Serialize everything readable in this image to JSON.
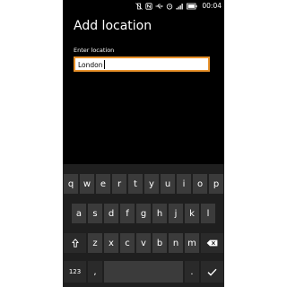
{
  "status": {
    "time": "00:04",
    "icons": [
      "vibrate-off-icon",
      "nfc-icon",
      "usb-icon",
      "alarm-icon",
      "signal-icon",
      "battery-icon"
    ]
  },
  "page": {
    "title": "Add location"
  },
  "location_field": {
    "label": "Enter location",
    "value": "London"
  },
  "keyboard": {
    "row1": [
      "q",
      "w",
      "e",
      "r",
      "t",
      "y",
      "u",
      "i",
      "o",
      "p"
    ],
    "row2": [
      "a",
      "s",
      "d",
      "f",
      "g",
      "h",
      "j",
      "k",
      "l"
    ],
    "row3": [
      "z",
      "x",
      "c",
      "v",
      "b",
      "n",
      "m"
    ],
    "numbers_label": "123",
    "comma_label": ",",
    "period_label": ".",
    "shift_icon": "shift-arrow-icon",
    "backspace_icon": "backspace-icon",
    "enter_icon": "checkmark-icon"
  }
}
